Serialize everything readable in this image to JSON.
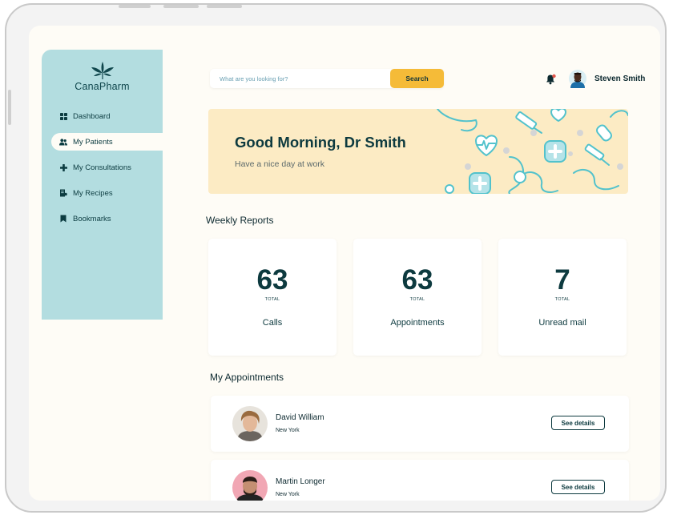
{
  "brand": {
    "name": "CanaPharm"
  },
  "sidebar": {
    "items": [
      {
        "label": "Dashboard",
        "icon": "grid-icon"
      },
      {
        "label": "My Patients",
        "icon": "users-icon",
        "active": true
      },
      {
        "label": "My Consultations",
        "icon": "plus-icon"
      },
      {
        "label": "My Recipes",
        "icon": "recipe-icon"
      },
      {
        "label": "Bookmarks",
        "icon": "bookmark-icon"
      }
    ]
  },
  "header": {
    "search_placeholder": "What are you looking for?",
    "search_button": "Search",
    "user_name": "Steven Smith"
  },
  "banner": {
    "greeting": "Good Morning, Dr Smith",
    "subtitle": "Have a nice day at work"
  },
  "weekly_reports": {
    "title": "Weekly Reports",
    "cards": [
      {
        "value": "63",
        "unit": "TOTAL",
        "label": "Calls"
      },
      {
        "value": "63",
        "unit": "TOTAL",
        "label": "Appointments"
      },
      {
        "value": "7",
        "unit": "TOTAL",
        "label": "Unread mail"
      }
    ]
  },
  "appointments": {
    "title": "My Appointments",
    "items": [
      {
        "name": "David William",
        "city": "New York",
        "button": "See details"
      },
      {
        "name": "Martin Longer",
        "city": "New York",
        "button": "See details"
      }
    ]
  },
  "colors": {
    "sidebar": "#b3dde0",
    "accent": "#f5bb38",
    "banner": "#fcebc4",
    "text_dark": "#0d3a3f",
    "notification_dot": "#e2574c"
  }
}
